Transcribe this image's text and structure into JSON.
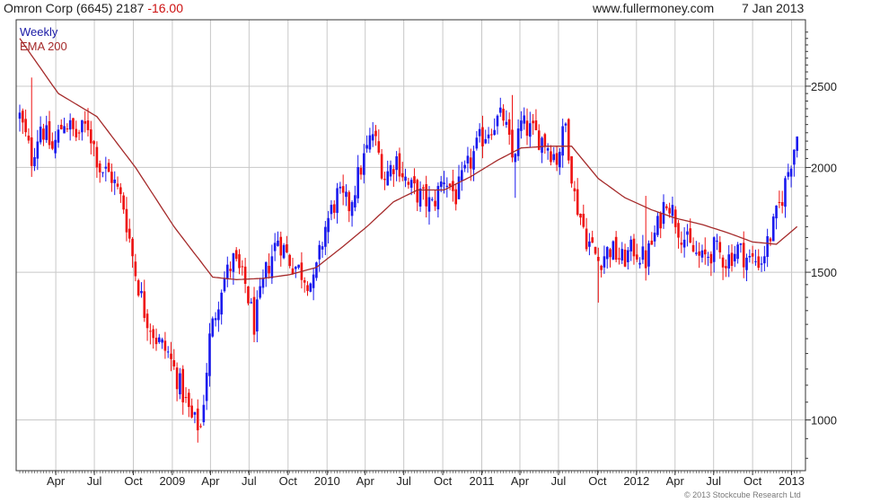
{
  "header": {
    "instrument": "Omron Corp (6645) 2187",
    "change": "-16.00",
    "website": "www.fullermoney.com",
    "date": "7 Jan 2013"
  },
  "legend": {
    "weekly_label": "Weekly",
    "ema_label": "EMA 200"
  },
  "footer": {
    "copyright": "© 2013 Stockcube Research Ltd"
  },
  "colors": {
    "up_candle": "#1a1aee",
    "down_candle": "#ee1111",
    "ema_line": "#a52a2a",
    "grid": "#c8c8c8",
    "axis": "#333333"
  },
  "chart_data": {
    "type": "candlestick",
    "frequency": "weekly",
    "y_scale": "log",
    "ylim": [
      870,
      3000
    ],
    "xlim": [
      "2008-01-07",
      "2013-01-21"
    ],
    "grid": true,
    "y_ticks": [
      1000,
      1500,
      2000,
      2500
    ],
    "x_ticks": [
      {
        "date": "2008-04-01",
        "label": "Apr"
      },
      {
        "date": "2008-07-01",
        "label": "Jul"
      },
      {
        "date": "2008-10-01",
        "label": "Oct"
      },
      {
        "date": "2009-01-01",
        "label": "2009"
      },
      {
        "date": "2009-04-01",
        "label": "Apr"
      },
      {
        "date": "2009-07-01",
        "label": "Jul"
      },
      {
        "date": "2009-10-01",
        "label": "Oct"
      },
      {
        "date": "2010-01-01",
        "label": "2010"
      },
      {
        "date": "2010-04-01",
        "label": "Apr"
      },
      {
        "date": "2010-07-01",
        "label": "Jul"
      },
      {
        "date": "2010-10-01",
        "label": "Oct"
      },
      {
        "date": "2011-01-01",
        "label": "2011"
      },
      {
        "date": "2011-04-01",
        "label": "Apr"
      },
      {
        "date": "2011-07-01",
        "label": "Jul"
      },
      {
        "date": "2011-10-01",
        "label": "Oct"
      },
      {
        "date": "2012-01-01",
        "label": "2012"
      },
      {
        "date": "2012-04-01",
        "label": "Apr"
      },
      {
        "date": "2012-07-01",
        "label": "Jul"
      },
      {
        "date": "2012-10-01",
        "label": "Oct"
      },
      {
        "date": "2013-01-01",
        "label": "2013"
      }
    ],
    "close_anchors": [
      [
        "2008-01-07",
        2300
      ],
      [
        "2008-02-04",
        2050
      ],
      [
        "2008-02-25",
        2250
      ],
      [
        "2008-03-24",
        2100
      ],
      [
        "2008-04-21",
        2280
      ],
      [
        "2008-05-19",
        2180
      ],
      [
        "2008-06-16",
        2250
      ],
      [
        "2008-07-14",
        2000
      ],
      [
        "2008-08-11",
        1950
      ],
      [
        "2008-09-08",
        1800
      ],
      [
        "2008-10-06",
        1500
      ],
      [
        "2008-10-27",
        1350
      ],
      [
        "2008-11-24",
        1250
      ],
      [
        "2008-12-22",
        1200
      ],
      [
        "2009-01-19",
        1100
      ],
      [
        "2009-02-16",
        1000
      ],
      [
        "2009-03-09",
        980
      ],
      [
        "2009-03-30",
        1250
      ],
      [
        "2009-04-27",
        1450
      ],
      [
        "2009-05-25",
        1550
      ],
      [
        "2009-06-22",
        1450
      ],
      [
        "2009-07-13",
        1300
      ],
      [
        "2009-08-10",
        1500
      ],
      [
        "2009-09-07",
        1650
      ],
      [
        "2009-10-05",
        1550
      ],
      [
        "2009-11-02",
        1500
      ],
      [
        "2009-11-30",
        1450
      ],
      [
        "2009-12-28",
        1700
      ],
      [
        "2010-01-25",
        1850
      ],
      [
        "2010-02-22",
        1800
      ],
      [
        "2010-03-22",
        2000
      ],
      [
        "2010-04-19",
        2200
      ],
      [
        "2010-05-17",
        1950
      ],
      [
        "2010-06-14",
        2050
      ],
      [
        "2010-07-12",
        1900
      ],
      [
        "2010-08-09",
        1850
      ],
      [
        "2010-09-06",
        1800
      ],
      [
        "2010-10-04",
        1950
      ],
      [
        "2010-11-01",
        1850
      ],
      [
        "2010-11-29",
        2000
      ],
      [
        "2010-12-27",
        2150
      ],
      [
        "2011-01-24",
        2250
      ],
      [
        "2011-02-21",
        2300
      ],
      [
        "2011-03-14",
        2050
      ],
      [
        "2011-04-04",
        2250
      ],
      [
        "2011-05-02",
        2200
      ],
      [
        "2011-05-30",
        2150
      ],
      [
        "2011-06-27",
        2050
      ],
      [
        "2011-07-18",
        2250
      ],
      [
        "2011-08-08",
        1850
      ],
      [
        "2011-09-05",
        1650
      ],
      [
        "2011-10-03",
        1550
      ],
      [
        "2011-10-31",
        1600
      ],
      [
        "2011-11-28",
        1550
      ],
      [
        "2011-12-26",
        1600
      ],
      [
        "2012-01-23",
        1550
      ],
      [
        "2012-02-20",
        1700
      ],
      [
        "2012-03-12",
        1850
      ],
      [
        "2012-04-09",
        1700
      ],
      [
        "2012-05-07",
        1600
      ],
      [
        "2012-06-04",
        1550
      ],
      [
        "2012-07-02",
        1600
      ],
      [
        "2012-07-30",
        1550
      ],
      [
        "2012-08-27",
        1600
      ],
      [
        "2012-09-24",
        1550
      ],
      [
        "2012-10-22",
        1550
      ],
      [
        "2012-11-19",
        1700
      ],
      [
        "2012-12-10",
        1850
      ],
      [
        "2012-12-31",
        2050
      ],
      [
        "2013-01-14",
        2187
      ]
    ],
    "ema200_anchors": [
      [
        "2008-01-07",
        2850
      ],
      [
        "2008-04-07",
        2450
      ],
      [
        "2008-07-07",
        2300
      ],
      [
        "2008-10-06",
        2000
      ],
      [
        "2009-01-05",
        1700
      ],
      [
        "2009-04-06",
        1480
      ],
      [
        "2009-06-01",
        1470
      ],
      [
        "2009-08-03",
        1475
      ],
      [
        "2009-10-05",
        1490
      ],
      [
        "2009-12-07",
        1520
      ],
      [
        "2010-02-01",
        1600
      ],
      [
        "2010-04-05",
        1700
      ],
      [
        "2010-06-07",
        1820
      ],
      [
        "2010-08-02",
        1880
      ],
      [
        "2010-10-04",
        1880
      ],
      [
        "2010-12-06",
        1950
      ],
      [
        "2011-02-07",
        2040
      ],
      [
        "2011-04-04",
        2110
      ],
      [
        "2011-06-06",
        2120
      ],
      [
        "2011-08-01",
        2120
      ],
      [
        "2011-10-03",
        1940
      ],
      [
        "2011-12-05",
        1840
      ],
      [
        "2012-02-06",
        1780
      ],
      [
        "2012-04-02",
        1740
      ],
      [
        "2012-06-04",
        1710
      ],
      [
        "2012-08-06",
        1670
      ],
      [
        "2012-10-01",
        1630
      ],
      [
        "2012-11-26",
        1620
      ],
      [
        "2013-01-14",
        1700
      ]
    ],
    "high_spikes": [
      [
        "2008-02-04",
        2560
      ],
      [
        "2011-03-14",
        2440
      ],
      [
        "2011-03-21",
        1840
      ],
      [
        "2012-01-23",
        1850
      ],
      [
        "2011-10-03",
        1380
      ]
    ]
  }
}
